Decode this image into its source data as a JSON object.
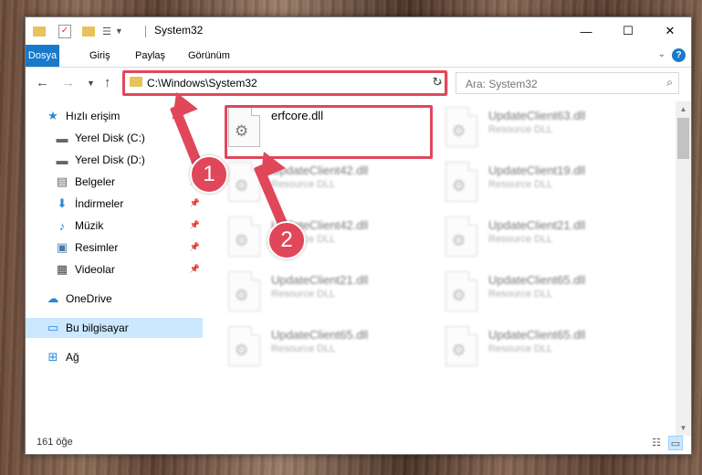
{
  "window": {
    "title": "System32",
    "controls": {
      "minimize": "—",
      "maximize": "☐",
      "close": "✕"
    }
  },
  "ribbon": {
    "tabs": [
      {
        "label": "Dosya"
      },
      {
        "label": "Giriş"
      },
      {
        "label": "Paylaş"
      },
      {
        "label": "Görünüm"
      }
    ],
    "help": "?"
  },
  "address": {
    "path": "C:\\Windows\\System32"
  },
  "search": {
    "placeholder": "Ara: System32"
  },
  "sidebar": {
    "items": [
      {
        "label": "Hızlı erişim",
        "icon": "star-icon"
      },
      {
        "label": "Yerel Disk (C:)",
        "icon": "drive-icon"
      },
      {
        "label": "Yerel Disk (D:)",
        "icon": "drive-icon"
      },
      {
        "label": "Belgeler",
        "icon": "documents-icon"
      },
      {
        "label": "İndirmeler",
        "icon": "download-icon"
      },
      {
        "label": "Müzik",
        "icon": "music-icon"
      },
      {
        "label": "Resimler",
        "icon": "pictures-icon"
      },
      {
        "label": "Videolar",
        "icon": "video-icon"
      },
      {
        "label": "OneDrive",
        "icon": "cloud-icon"
      },
      {
        "label": "Bu bilgisayar",
        "icon": "computer-icon"
      },
      {
        "label": "Ağ",
        "icon": "network-icon"
      }
    ]
  },
  "files": {
    "highlighted": {
      "name": "erfcore.dll"
    },
    "others": [
      {
        "name": "UpdateClient63.dll",
        "type": "Resource DLL"
      },
      {
        "name": "UpdateClient42.dll",
        "type": "Resource DLL"
      },
      {
        "name": "UpdateClient19.dll",
        "type": "Resource DLL"
      },
      {
        "name": "UpdateClient42.dll",
        "type": "Resource DLL"
      },
      {
        "name": "UpdateClient21.dll",
        "type": "Resource DLL"
      },
      {
        "name": "UpdateClient21.dll",
        "type": "Resource DLL"
      },
      {
        "name": "UpdateClient65.dll",
        "type": "Resource DLL"
      },
      {
        "name": "UpdateClient65.dll",
        "type": "Resource DLL"
      },
      {
        "name": "UpdateClient65.dll",
        "type": "Resource DLL"
      }
    ]
  },
  "status": {
    "count": "161 öğe"
  },
  "annotations": {
    "step1": "1",
    "step2": "2",
    "color": "#e0475a"
  }
}
